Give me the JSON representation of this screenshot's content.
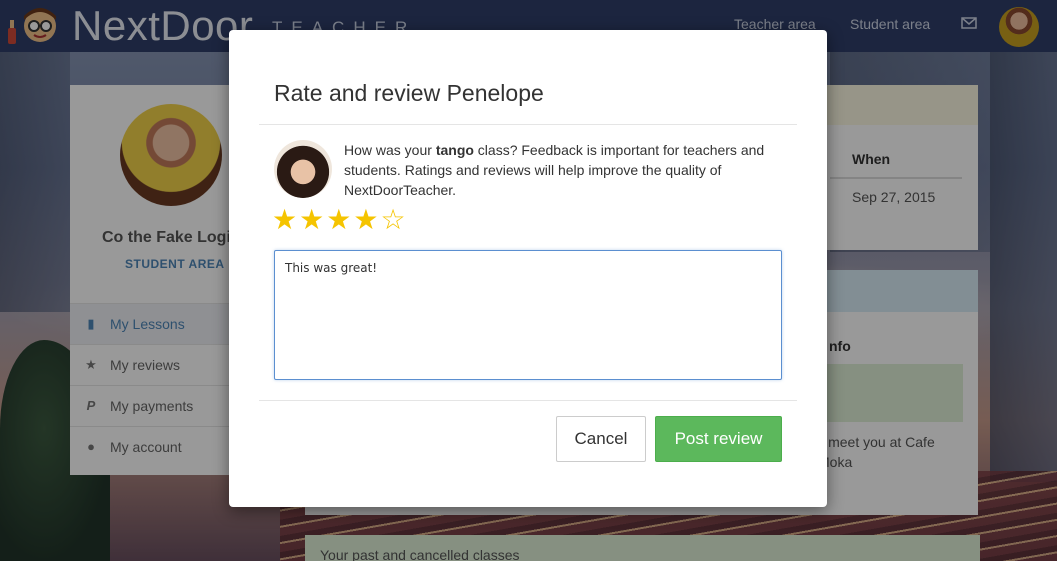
{
  "header": {
    "brand": "NextDoor",
    "brand_sub": "TEACHER",
    "nav": {
      "teacher_area": "Teacher area",
      "student_area": "Student area"
    }
  },
  "sidebar": {
    "name": "Co the Fake Logi",
    "role": "STUDENT AREA",
    "items": [
      {
        "label": "My Lessons",
        "icon": "book-icon",
        "active": true
      },
      {
        "label": "My reviews",
        "icon": "star-icon",
        "active": false
      },
      {
        "label": "My payments",
        "icon": "paypal-icon",
        "active": false
      },
      {
        "label": "My account",
        "icon": "user-icon",
        "active": false
      }
    ]
  },
  "content": {
    "col_when": "When",
    "date": "Sep 27, 2015",
    "info_heading": "nfo",
    "info_text": "ll meet you at Cafe Moka",
    "past_classes": "Your past and cancelled classes"
  },
  "modal": {
    "title": "Rate and review Penelope",
    "question_pre": "How was your ",
    "question_subject": "tango",
    "question_post": " class? Feedback is important for teachers and students. Ratings and reviews will help improve the quality of NextDoorTeacher.",
    "rating": 4,
    "rating_max": 5,
    "review_text": "This was great!",
    "cancel_label": "Cancel",
    "post_label": "Post review"
  },
  "colors": {
    "header_bg": "#2f3f6a",
    "accent_blue": "#4e86b8",
    "star_gold": "#f5c400",
    "post_green": "#5cb85c"
  }
}
